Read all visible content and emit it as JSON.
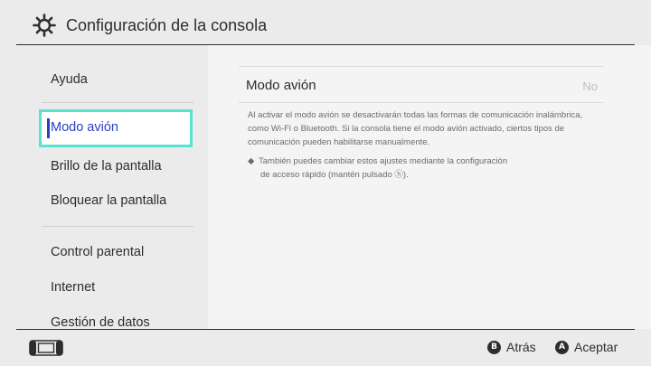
{
  "header": {
    "title": "Configuración de la consola",
    "icon": "gear-icon"
  },
  "sidebar": {
    "items": [
      {
        "label": "Ayuda"
      },
      {
        "label": "Modo avión",
        "selected": true
      },
      {
        "label": "Brillo de la pantalla"
      },
      {
        "label": "Bloquear la pantalla"
      },
      {
        "label": "Control parental"
      },
      {
        "label": "Internet"
      },
      {
        "label": "Gestión de datos"
      }
    ]
  },
  "main": {
    "setting_label": "Modo avión",
    "setting_value": "No",
    "description": "Al activar el modo avión se desactivarán todas las formas de comunicación inalámbrica, como Wi-Fi o Bluetooth. Si la consola tiene el modo avión activado, ciertos tipos de comunicación pueden habilitarse manualmente.",
    "note_line1": "También puedes cambiar estos ajustes mediante la configuración",
    "note_line2": "de acceso rápido (mantén pulsado ⓗ).",
    "note_bullet": "◆"
  },
  "footer": {
    "back_key": "B",
    "back_label": "Atrás",
    "accept_key": "A",
    "accept_label": "Aceptar",
    "console_icon": "handheld-console-icon"
  },
  "colors": {
    "selection_border": "#5be3d2",
    "selection_text": "#2a3fc2"
  }
}
